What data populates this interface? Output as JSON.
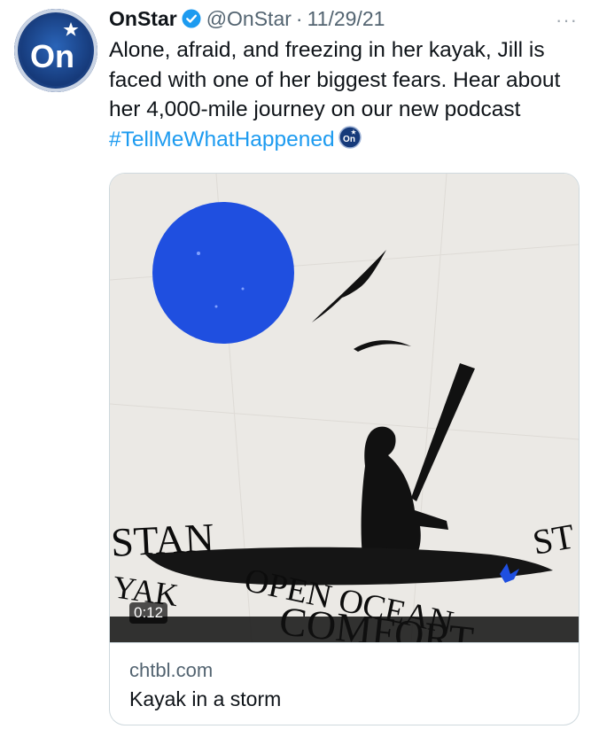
{
  "tweet": {
    "author_name": "OnStar",
    "handle": "@OnStar",
    "separator": "·",
    "date": "11/29/21",
    "more_label": "···",
    "text": "Alone, afraid, and freezing in her kayak, Jill is faced with one of her biggest fears. Hear about her 4,000-mile journey on our new podcast ",
    "hashtag": "#TellMeWhatHappened",
    "avatar_logo_text": "On",
    "emoji_text": "On",
    "icons": [
      "verified-badge-icon",
      "more-options-icon",
      "onstar-emoji-icon"
    ]
  },
  "card": {
    "media_duration": "0:12",
    "domain": "chtbl.com",
    "title": "Kayak in a storm",
    "media_scene_text": [
      "STAN",
      "YAK",
      "OPEN OCEAN",
      "COMFORT",
      "ST"
    ]
  },
  "colors": {
    "link": "#1d9bf0",
    "moon_blue": "#1f4fe0",
    "avatar_blue": "#163a7a",
    "secondary_text": "#536471"
  }
}
